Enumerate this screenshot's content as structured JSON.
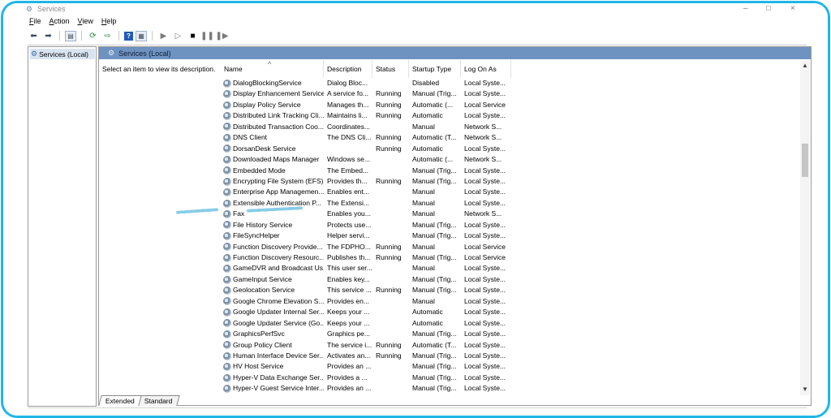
{
  "window": {
    "title": "Services",
    "controls": [
      "–",
      "□",
      "×"
    ]
  },
  "menu": [
    {
      "label": "File",
      "key": "F"
    },
    {
      "label": "Action",
      "key": "A"
    },
    {
      "label": "View",
      "key": "V"
    },
    {
      "label": "Help",
      "key": "H"
    }
  ],
  "toolbar": {
    "icons": [
      "back-arrow-icon",
      "forward-arrow-icon",
      "console-tree-icon",
      "refresh-icon",
      "export-list-icon",
      "help-icon",
      "properties-icon",
      "start-service-icon",
      "start-service-alt-icon",
      "stop-service-icon",
      "pause-service-icon",
      "resume-service-icon"
    ]
  },
  "tree": {
    "root_label": "Services (Local)"
  },
  "pane": {
    "header": "Services (Local)",
    "description_hint": "Select an item to view its description."
  },
  "columns": {
    "name": "Name",
    "description": "Description",
    "status": "Status",
    "startup_type": "Startup Type",
    "log_on_as": "Log On As"
  },
  "services": [
    {
      "name": "DialogBlockingService",
      "description": "Dialog Bloc...",
      "status": "",
      "startup": "Disabled",
      "logon": "Local Syste..."
    },
    {
      "name": "Display Enhancement Service",
      "description": "A service fo...",
      "status": "Running",
      "startup": "Manual (Trig...",
      "logon": "Local Syste..."
    },
    {
      "name": "Display Policy Service",
      "description": "Manages th...",
      "status": "Running",
      "startup": "Automatic (...",
      "logon": "Local Service"
    },
    {
      "name": "Distributed Link Tracking Cli...",
      "description": "Maintains li...",
      "status": "Running",
      "startup": "Automatic",
      "logon": "Local Syste..."
    },
    {
      "name": "Distributed Transaction Coo...",
      "description": "Coordinates...",
      "status": "",
      "startup": "Manual",
      "logon": "Network S..."
    },
    {
      "name": "DNS Client",
      "description": "The DNS Cli...",
      "status": "Running",
      "startup": "Automatic (T...",
      "logon": "Network S..."
    },
    {
      "name": "DorsanDesk Service",
      "description": "",
      "status": "Running",
      "startup": "Automatic",
      "logon": "Local Syste..."
    },
    {
      "name": "Downloaded Maps Manager",
      "description": "Windows se...",
      "status": "",
      "startup": "Automatic (...",
      "logon": "Network S..."
    },
    {
      "name": "Embedded Mode",
      "description": "The Embed...",
      "status": "",
      "startup": "Manual (Trig...",
      "logon": "Local Syste..."
    },
    {
      "name": "Encrypting File System (EFS)",
      "description": "Provides th...",
      "status": "Running",
      "startup": "Manual (Trig...",
      "logon": "Local Syste..."
    },
    {
      "name": "Enterprise App Managemen...",
      "description": "Enables ent...",
      "status": "",
      "startup": "Manual",
      "logon": "Local Syste..."
    },
    {
      "name": "Extensible Authentication P...",
      "description": "The Extensi...",
      "status": "",
      "startup": "Manual",
      "logon": "Local Syste..."
    },
    {
      "name": "Fax",
      "description": "Enables you...",
      "status": "",
      "startup": "Manual",
      "logon": "Network S..."
    },
    {
      "name": "File History Service",
      "description": "Protects use...",
      "status": "",
      "startup": "Manual (Trig...",
      "logon": "Local Syste..."
    },
    {
      "name": "FileSyncHelper",
      "description": "Helper servi...",
      "status": "",
      "startup": "Manual (Trig...",
      "logon": "Local Syste..."
    },
    {
      "name": "Function Discovery Provide...",
      "description": "The FDPHO...",
      "status": "Running",
      "startup": "Manual",
      "logon": "Local Service"
    },
    {
      "name": "Function Discovery Resourc...",
      "description": "Publishes th...",
      "status": "Running",
      "startup": "Manual (Trig...",
      "logon": "Local Service"
    },
    {
      "name": "GameDVR and Broadcast Us...",
      "description": "This user ser...",
      "status": "",
      "startup": "Manual",
      "logon": "Local Syste..."
    },
    {
      "name": "GameInput Service",
      "description": "Enables key...",
      "status": "",
      "startup": "Manual (Trig...",
      "logon": "Local Syste..."
    },
    {
      "name": "Geolocation Service",
      "description": "This service ...",
      "status": "Running",
      "startup": "Manual (Trig...",
      "logon": "Local Syste..."
    },
    {
      "name": "Google Chrome Elevation S...",
      "description": "Provides en...",
      "status": "",
      "startup": "Manual",
      "logon": "Local Syste..."
    },
    {
      "name": "Google Updater Internal Ser...",
      "description": "Keeps your ...",
      "status": "",
      "startup": "Automatic",
      "logon": "Local Syste..."
    },
    {
      "name": "Google Updater Service (Go...",
      "description": "Keeps your ...",
      "status": "",
      "startup": "Automatic",
      "logon": "Local Syste..."
    },
    {
      "name": "GraphicsPerfSvc",
      "description": "Graphics pe...",
      "status": "",
      "startup": "Manual (Trig...",
      "logon": "Local Syste..."
    },
    {
      "name": "Group Policy Client",
      "description": "The service i...",
      "status": "Running",
      "startup": "Automatic (T...",
      "logon": "Local Syste..."
    },
    {
      "name": "Human Interface Device Ser...",
      "description": "Activates an...",
      "status": "Running",
      "startup": "Manual (Trig...",
      "logon": "Local Syste..."
    },
    {
      "name": "HV Host Service",
      "description": "Provides an ...",
      "status": "",
      "startup": "Manual (Trig...",
      "logon": "Local Syste..."
    },
    {
      "name": "Hyper-V Data Exchange Ser...",
      "description": "Provides a ...",
      "status": "",
      "startup": "Manual (Trig...",
      "logon": "Local Syste..."
    },
    {
      "name": "Hyper-V Guest Service Inter...",
      "description": "Provides an ...",
      "status": "",
      "startup": "Manual (Trig...",
      "logon": "Local Syste..."
    }
  ],
  "tabs": [
    {
      "label": "Extended",
      "active": true
    },
    {
      "label": "Standard",
      "active": false
    }
  ],
  "colors": {
    "frame": "#1fb6e6",
    "pane_header": "#6f93c0",
    "annotation": "#86cde7"
  }
}
